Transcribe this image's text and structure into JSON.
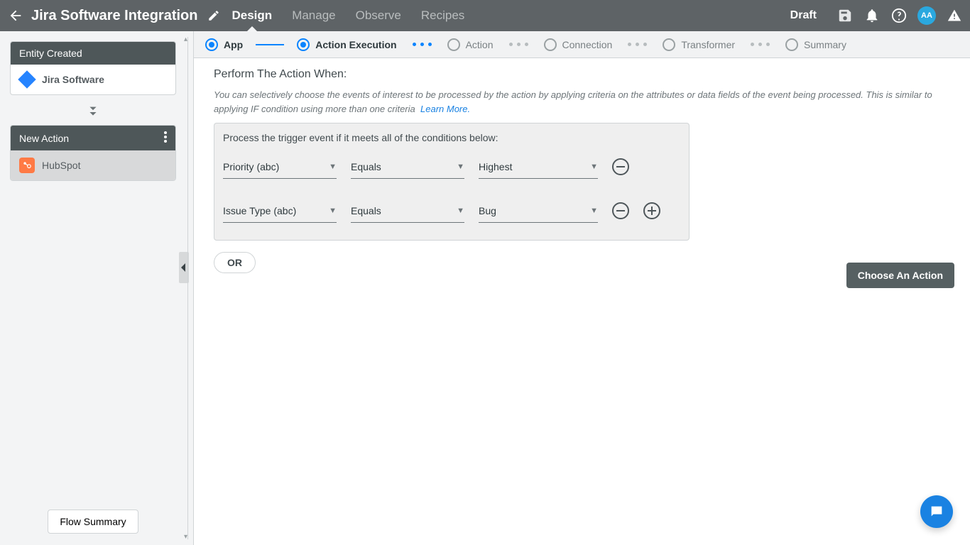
{
  "header": {
    "title": "Jira Software Integration",
    "tabs": [
      "Design",
      "Manage",
      "Observe",
      "Recipes"
    ],
    "active_tab": "Design",
    "status": "Draft",
    "avatar": "AA"
  },
  "sidebar": {
    "trigger_block": {
      "title": "Entity Created",
      "app": "Jira Software"
    },
    "action_block": {
      "title": "New Action",
      "app": "HubSpot"
    },
    "flow_summary_btn": "Flow Summary"
  },
  "wizard": {
    "steps": [
      "App",
      "Action Execution",
      "Action",
      "Connection",
      "Transformer",
      "Summary"
    ],
    "current": "Action Execution"
  },
  "content": {
    "heading": "Perform The Action When:",
    "description": "You can selectively choose the events of interest to be processed by the action by applying criteria on the attributes or data fields of the event being processed. This is similar to applying IF condition using more than one criteria",
    "learn_more": "Learn More.",
    "panel_title": "Process the trigger event if it meets all of the conditions below:",
    "conditions": [
      {
        "field": "Priority (abc)",
        "operator": "Equals",
        "value": "Highest",
        "show_add": false
      },
      {
        "field": "Issue Type (abc)",
        "operator": "Equals",
        "value": "Bug",
        "show_add": true
      }
    ],
    "or_btn": "OR",
    "choose_action_btn": "Choose An Action"
  }
}
